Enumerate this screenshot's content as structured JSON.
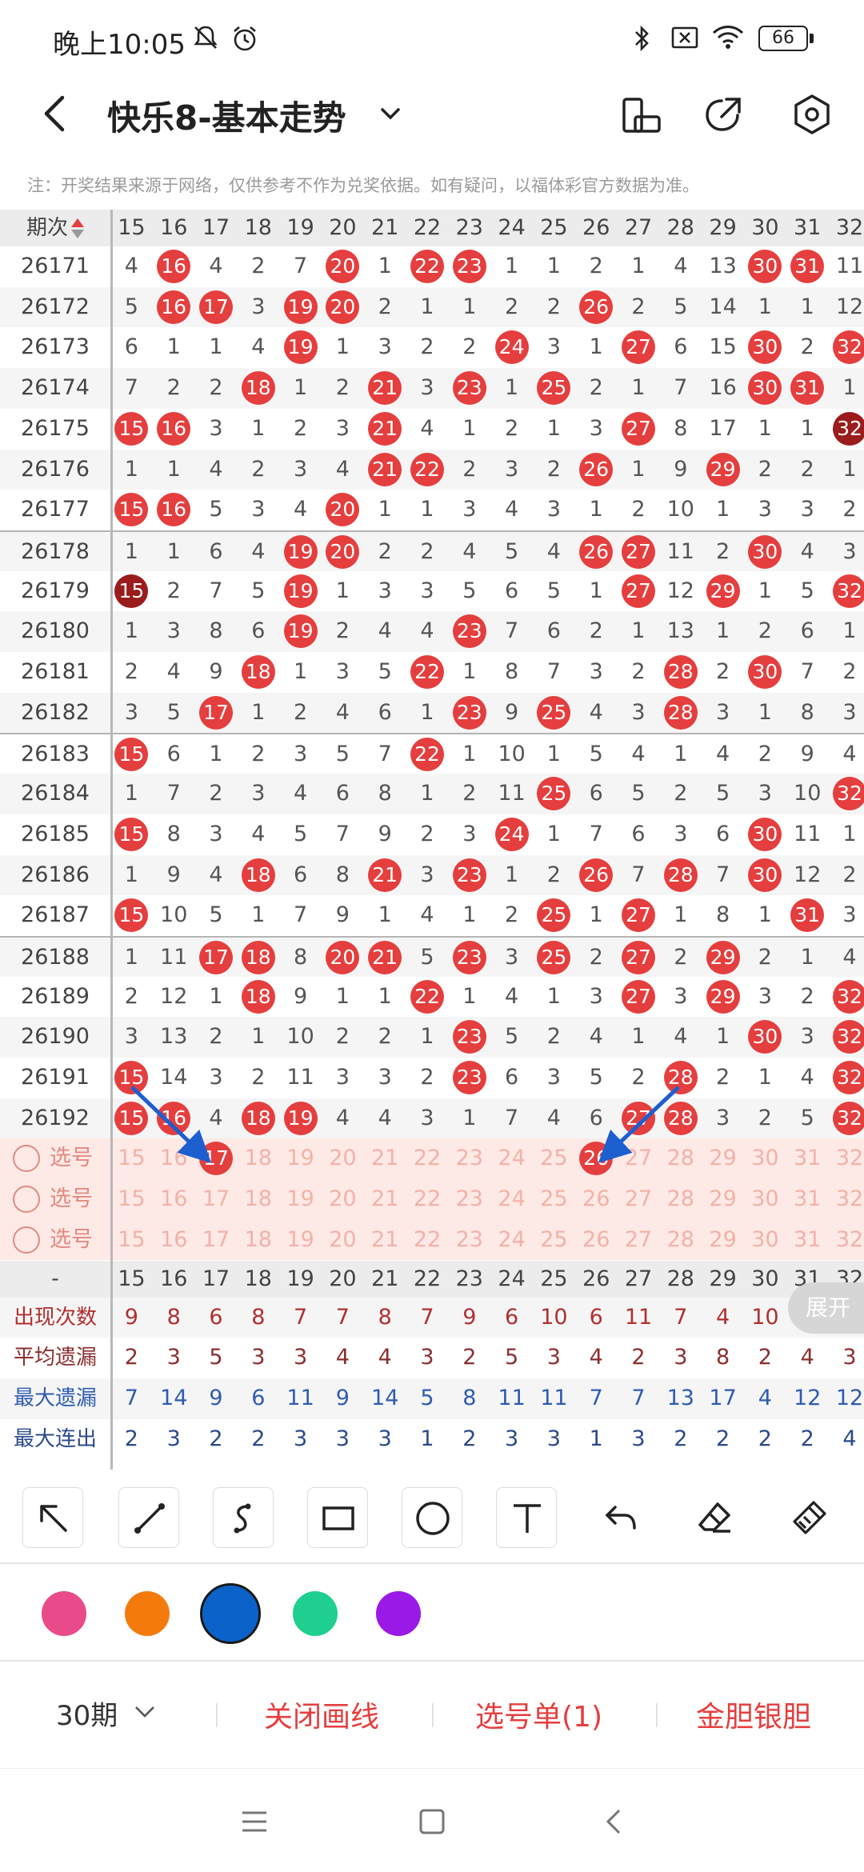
{
  "status": {
    "time": "晚上10:05",
    "battery": "66"
  },
  "header": {
    "title": "快乐8-基本走势"
  },
  "notice": "注：开奖结果来源于网络，仅供参考不作为兑奖依据。如有疑问，以福体彩官方数据为准。",
  "table": {
    "period_header": "期次",
    "columns": [
      "15",
      "16",
      "17",
      "18",
      "19",
      "20",
      "21",
      "22",
      "23",
      "24",
      "25",
      "26",
      "27",
      "28",
      "29",
      "30",
      "31",
      "32"
    ],
    "rows": [
      {
        "period": "26171",
        "cells": [
          "4",
          "16",
          "4",
          "2",
          "7",
          "20",
          "1",
          "22",
          "23",
          "1",
          "1",
          "2",
          "1",
          "4",
          "13",
          "30",
          "31",
          "11"
        ],
        "hits": [
          1,
          5,
          7,
          8,
          15,
          16
        ]
      },
      {
        "period": "26172",
        "cells": [
          "5",
          "16",
          "17",
          "3",
          "19",
          "20",
          "2",
          "1",
          "1",
          "2",
          "2",
          "26",
          "2",
          "5",
          "14",
          "1",
          "1",
          "12"
        ],
        "hits": [
          1,
          2,
          4,
          5,
          11
        ]
      },
      {
        "period": "26173",
        "cells": [
          "6",
          "1",
          "1",
          "4",
          "19",
          "1",
          "3",
          "2",
          "2",
          "24",
          "3",
          "1",
          "27",
          "6",
          "15",
          "30",
          "2",
          "32"
        ],
        "hits": [
          4,
          9,
          12,
          15,
          17
        ]
      },
      {
        "period": "26174",
        "cells": [
          "7",
          "2",
          "2",
          "18",
          "1",
          "2",
          "21",
          "3",
          "23",
          "1",
          "25",
          "2",
          "1",
          "7",
          "16",
          "30",
          "31",
          "1"
        ],
        "hits": [
          3,
          6,
          8,
          10,
          15,
          16
        ]
      },
      {
        "period": "26175",
        "cells": [
          "15",
          "16",
          "3",
          "1",
          "2",
          "3",
          "21",
          "4",
          "1",
          "2",
          "1",
          "3",
          "27",
          "8",
          "17",
          "1",
          "1",
          "32"
        ],
        "hits": [
          0,
          1,
          6,
          12,
          17
        ],
        "dark": [
          17
        ]
      },
      {
        "period": "26176",
        "cells": [
          "1",
          "1",
          "4",
          "2",
          "3",
          "4",
          "21",
          "22",
          "2",
          "3",
          "2",
          "26",
          "1",
          "9",
          "29",
          "2",
          "2",
          "1"
        ],
        "hits": [
          6,
          7,
          11,
          14
        ]
      },
      {
        "period": "26177",
        "cells": [
          "15",
          "16",
          "5",
          "3",
          "4",
          "20",
          "1",
          "1",
          "3",
          "4",
          "3",
          "1",
          "2",
          "10",
          "1",
          "3",
          "3",
          "2"
        ],
        "hits": [
          0,
          1,
          5
        ]
      },
      {
        "period": "26178",
        "cells": [
          "1",
          "1",
          "6",
          "4",
          "19",
          "20",
          "2",
          "2",
          "4",
          "5",
          "4",
          "26",
          "27",
          "11",
          "2",
          "30",
          "4",
          "3"
        ],
        "hits": [
          4,
          5,
          11,
          12,
          15
        ]
      },
      {
        "period": "26179",
        "cells": [
          "15",
          "2",
          "7",
          "5",
          "19",
          "1",
          "3",
          "3",
          "5",
          "6",
          "5",
          "1",
          "27",
          "12",
          "29",
          "1",
          "5",
          "32"
        ],
        "hits": [
          0,
          4,
          12,
          14,
          17
        ],
        "dark": [
          0
        ]
      },
      {
        "period": "26180",
        "cells": [
          "1",
          "3",
          "8",
          "6",
          "19",
          "2",
          "4",
          "4",
          "23",
          "7",
          "6",
          "2",
          "1",
          "13",
          "1",
          "2",
          "6",
          "1"
        ],
        "hits": [
          4,
          8
        ]
      },
      {
        "period": "26181",
        "cells": [
          "2",
          "4",
          "9",
          "18",
          "1",
          "3",
          "5",
          "22",
          "1",
          "8",
          "7",
          "3",
          "2",
          "28",
          "2",
          "30",
          "7",
          "2"
        ],
        "hits": [
          3,
          7,
          13,
          15
        ]
      },
      {
        "period": "26182",
        "cells": [
          "3",
          "5",
          "17",
          "1",
          "2",
          "4",
          "6",
          "1",
          "23",
          "9",
          "25",
          "4",
          "3",
          "28",
          "3",
          "1",
          "8",
          "3"
        ],
        "hits": [
          2,
          8,
          10,
          13
        ]
      },
      {
        "period": "26183",
        "cells": [
          "15",
          "6",
          "1",
          "2",
          "3",
          "5",
          "7",
          "22",
          "1",
          "10",
          "1",
          "5",
          "4",
          "1",
          "4",
          "2",
          "9",
          "4"
        ],
        "hits": [
          0,
          7
        ]
      },
      {
        "period": "26184",
        "cells": [
          "1",
          "7",
          "2",
          "3",
          "4",
          "6",
          "8",
          "1",
          "2",
          "11",
          "25",
          "6",
          "5",
          "2",
          "5",
          "3",
          "10",
          "32"
        ],
        "hits": [
          10,
          17
        ]
      },
      {
        "period": "26185",
        "cells": [
          "15",
          "8",
          "3",
          "4",
          "5",
          "7",
          "9",
          "2",
          "3",
          "24",
          "1",
          "7",
          "6",
          "3",
          "6",
          "30",
          "11",
          "1"
        ],
        "hits": [
          0,
          9,
          15
        ]
      },
      {
        "period": "26186",
        "cells": [
          "1",
          "9",
          "4",
          "18",
          "6",
          "8",
          "21",
          "3",
          "23",
          "1",
          "2",
          "26",
          "7",
          "28",
          "7",
          "30",
          "12",
          "2"
        ],
        "hits": [
          3,
          6,
          8,
          11,
          13,
          15
        ]
      },
      {
        "period": "26187",
        "cells": [
          "15",
          "10",
          "5",
          "1",
          "7",
          "9",
          "1",
          "4",
          "1",
          "2",
          "25",
          "1",
          "27",
          "1",
          "8",
          "1",
          "31",
          "3"
        ],
        "hits": [
          0,
          10,
          12,
          16
        ]
      },
      {
        "period": "26188",
        "cells": [
          "1",
          "11",
          "17",
          "18",
          "8",
          "20",
          "21",
          "5",
          "23",
          "3",
          "25",
          "2",
          "27",
          "2",
          "29",
          "2",
          "1",
          "4"
        ],
        "hits": [
          2,
          3,
          5,
          6,
          8,
          10,
          12,
          14
        ]
      },
      {
        "period": "26189",
        "cells": [
          "2",
          "12",
          "1",
          "18",
          "9",
          "1",
          "1",
          "22",
          "1",
          "4",
          "1",
          "3",
          "27",
          "3",
          "29",
          "3",
          "2",
          "32"
        ],
        "hits": [
          3,
          7,
          12,
          14,
          17
        ]
      },
      {
        "period": "26190",
        "cells": [
          "3",
          "13",
          "2",
          "1",
          "10",
          "2",
          "2",
          "1",
          "23",
          "5",
          "2",
          "4",
          "1",
          "4",
          "1",
          "30",
          "3",
          "32"
        ],
        "hits": [
          8,
          15,
          17
        ]
      },
      {
        "period": "26191",
        "cells": [
          "15",
          "14",
          "3",
          "2",
          "11",
          "3",
          "3",
          "2",
          "23",
          "6",
          "3",
          "5",
          "2",
          "28",
          "2",
          "1",
          "4",
          "32"
        ],
        "hits": [
          0,
          8,
          13,
          17
        ]
      },
      {
        "period": "26192",
        "cells": [
          "15",
          "16",
          "4",
          "18",
          "19",
          "4",
          "4",
          "3",
          "1",
          "7",
          "4",
          "6",
          "27",
          "28",
          "3",
          "2",
          "5",
          "32"
        ],
        "hits": [
          0,
          1,
          3,
          4,
          12,
          13,
          17
        ]
      }
    ],
    "selection_label": "选号",
    "selection_rows": [
      {
        "picked": [
          2,
          11
        ]
      },
      {
        "picked": []
      },
      {
        "picked": []
      }
    ]
  },
  "stats": {
    "header_dash": "-",
    "rows": [
      {
        "label": "出现次数",
        "color": "#b03030",
        "values": [
          "9",
          "8",
          "6",
          "8",
          "7",
          "7",
          "8",
          "7",
          "9",
          "6",
          "10",
          "6",
          "11",
          "7",
          "4",
          "10",
          "",
          ""
        ]
      },
      {
        "label": "平均遗漏",
        "color": "#8b2f2f",
        "values": [
          "2",
          "3",
          "5",
          "3",
          "3",
          "4",
          "4",
          "3",
          "2",
          "5",
          "3",
          "4",
          "2",
          "3",
          "8",
          "2",
          "4",
          "3"
        ]
      },
      {
        "label": "最大遗漏",
        "color": "#2f5cb0",
        "values": [
          "7",
          "14",
          "9",
          "6",
          "11",
          "9",
          "14",
          "5",
          "8",
          "11",
          "11",
          "7",
          "7",
          "13",
          "17",
          "4",
          "12",
          "12"
        ]
      },
      {
        "label": "最大连出",
        "color": "#2b4a8a",
        "values": [
          "2",
          "3",
          "2",
          "2",
          "3",
          "3",
          "3",
          "1",
          "2",
          "3",
          "3",
          "1",
          "3",
          "2",
          "2",
          "2",
          "2",
          "4"
        ]
      }
    ],
    "expand_label": "展开"
  },
  "colors": {
    "accent": "#e53e3e",
    "swatches": [
      "#e94b8a",
      "#f57a0e",
      "#0b63c9",
      "#1ecf8f",
      "#9b19e6"
    ],
    "selected_swatch": 2
  },
  "bottom": {
    "period_select": "30期",
    "close_lines": "关闭画线",
    "pick_list": "选号单(1)",
    "gold_silver": "金胆银胆"
  }
}
